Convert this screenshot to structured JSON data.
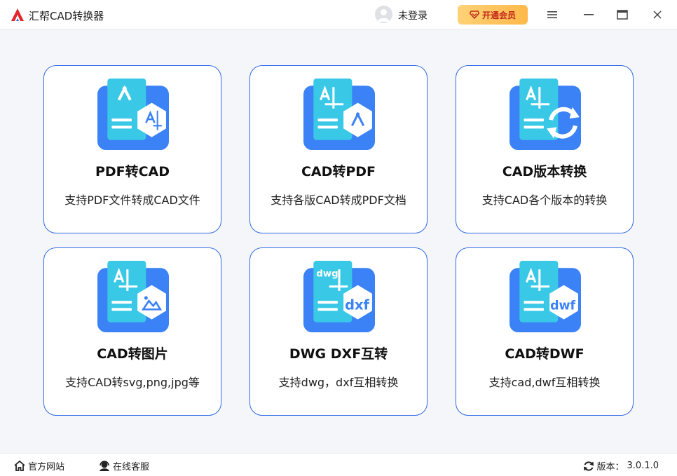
{
  "app": {
    "title": "汇帮CAD转换器"
  },
  "header": {
    "login_label": "未登录",
    "vip_label": "开通会员"
  },
  "cards": [
    {
      "title": "PDF转CAD",
      "desc": "支持PDF文件转成CAD文件",
      "icon": "pdf-to-cad-icon"
    },
    {
      "title": "CAD转PDF",
      "desc": "支持各版CAD转成PDF文档",
      "icon": "cad-to-pdf-icon"
    },
    {
      "title": "CAD版本转换",
      "desc": "支持CAD各个版本的转换",
      "icon": "cad-version-convert-icon"
    },
    {
      "title": "CAD转图片",
      "desc": "支持CAD转svg,png,jpg等",
      "icon": "cad-to-image-icon"
    },
    {
      "title": "DWG DXF互转",
      "desc": "支持dwg，dxf互相转换",
      "icon": "dwg-dxf-convert-icon",
      "badge_top": "dwg",
      "badge_bottom": "dxf"
    },
    {
      "title": "CAD转DWF",
      "desc": "支持cad,dwf互相转换",
      "icon": "cad-to-dwf-icon",
      "badge_bottom": "dwf"
    }
  ],
  "footer": {
    "website_label": "官方网站",
    "support_label": "在线客服",
    "version_label": "版本：",
    "version_value": "3.0.1.0"
  },
  "colors": {
    "accent": "#2f6ae6",
    "icon_blue": "#3a82f6",
    "icon_cyan": "#39c8e6",
    "vip_text": "#c2281b"
  }
}
